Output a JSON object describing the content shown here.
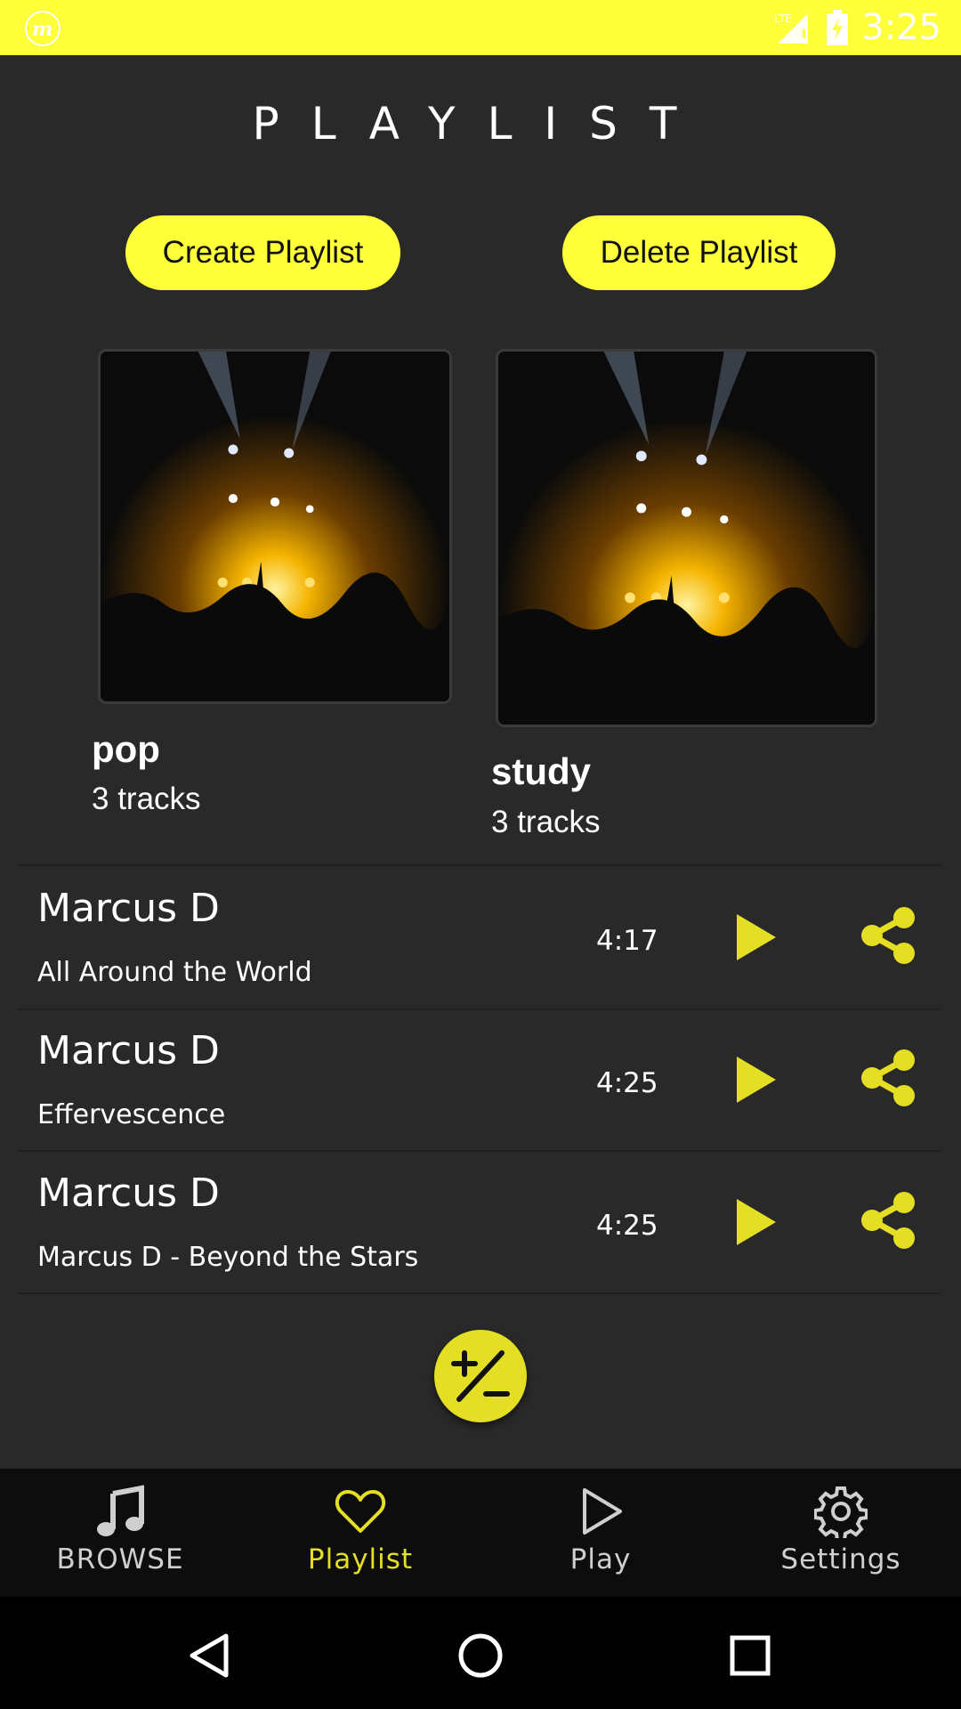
{
  "status_bar": {
    "time": "3:25",
    "network": "LTE",
    "bg_color": "#ffff3a"
  },
  "header": {
    "title": "PLAYLIST"
  },
  "actions": {
    "create_label": "Create Playlist",
    "delete_label": "Delete Playlist",
    "accent": "#ffff3a"
  },
  "playlists": [
    {
      "name": "pop",
      "tracks": "3 tracks",
      "image": "concert-crowd-image"
    },
    {
      "name": "study",
      "tracks": "3 tracks",
      "image": "concert-crowd-image"
    }
  ],
  "tracks": [
    {
      "artist": "Marcus D",
      "title": "All Around the World",
      "duration": "4:17"
    },
    {
      "artist": "Marcus D",
      "title": "Effervescence",
      "duration": "4:25"
    },
    {
      "artist": "Marcus D",
      "title": "Marcus D - Beyond the Stars",
      "duration": "4:25"
    }
  ],
  "fab": {
    "icon": "plus-minus-icon"
  },
  "bottom_nav": {
    "items": [
      {
        "label": "BROWSE",
        "icon": "music-note-icon"
      },
      {
        "label": "Playlist",
        "icon": "heart-icon",
        "active": true
      },
      {
        "label": "Play",
        "icon": "play-outline-icon"
      },
      {
        "label": "Settings",
        "icon": "gear-icon"
      }
    ],
    "active_color": "#e4df24"
  },
  "system_nav": [
    "back-icon",
    "home-icon",
    "recents-icon"
  ]
}
